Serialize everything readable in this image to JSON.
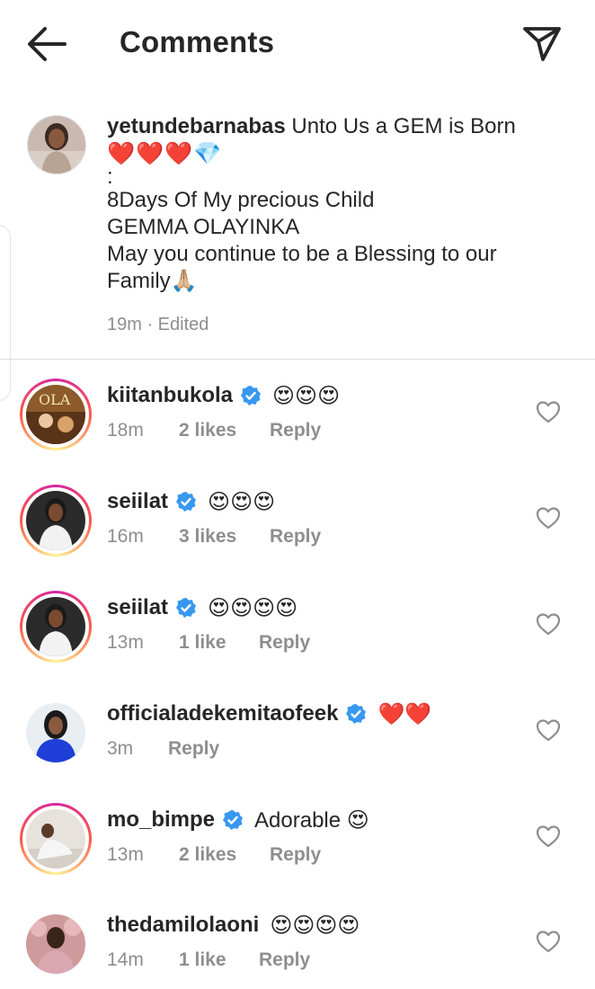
{
  "header": {
    "title": "Comments",
    "back_icon": "arrow-left-icon",
    "share_icon": "paper-plane-icon"
  },
  "caption": {
    "username": "yetundebarnabas",
    "first_line": "Unto Us a GEM is Born",
    "emojis": "❤️❤️❤️💎",
    "line2": ":",
    "line3": "8Days Of My precious Child",
    "line4": "GEMMA OLAYINKA",
    "line5": "May you continue to be a Blessing to our",
    "line6": "Family🙏🏼",
    "meta": "19m · Edited"
  },
  "comments": [
    {
      "username": "kiitanbukola",
      "verified": true,
      "text": "😍😍😍",
      "time": "18m",
      "likes": "2 likes",
      "reply": "Reply"
    },
    {
      "username": "seiilat",
      "verified": true,
      "text": "😍😍😍",
      "time": "16m",
      "likes": "3 likes",
      "reply": "Reply"
    },
    {
      "username": "seiilat",
      "verified": true,
      "text": "😍😍😍😍",
      "time": "13m",
      "likes": "1 like",
      "reply": "Reply"
    },
    {
      "username": "officialadekemitaofeek",
      "verified": true,
      "text": "❤️❤️",
      "time": "3m",
      "likes": "",
      "reply": "Reply"
    },
    {
      "username": "mo_bimpe",
      "verified": true,
      "text": "Adorable 😍",
      "time": "13m",
      "likes": "2 likes",
      "reply": "Reply"
    },
    {
      "username": "thedamilolaoni",
      "verified": false,
      "text": "😍😍😍😍",
      "time": "14m",
      "likes": "1 like",
      "reply": "Reply"
    }
  ],
  "colors": {
    "text": "#262626",
    "secondary": "#8e8e8e",
    "verified": "#3897f0",
    "divider": "#dbdbdb"
  }
}
